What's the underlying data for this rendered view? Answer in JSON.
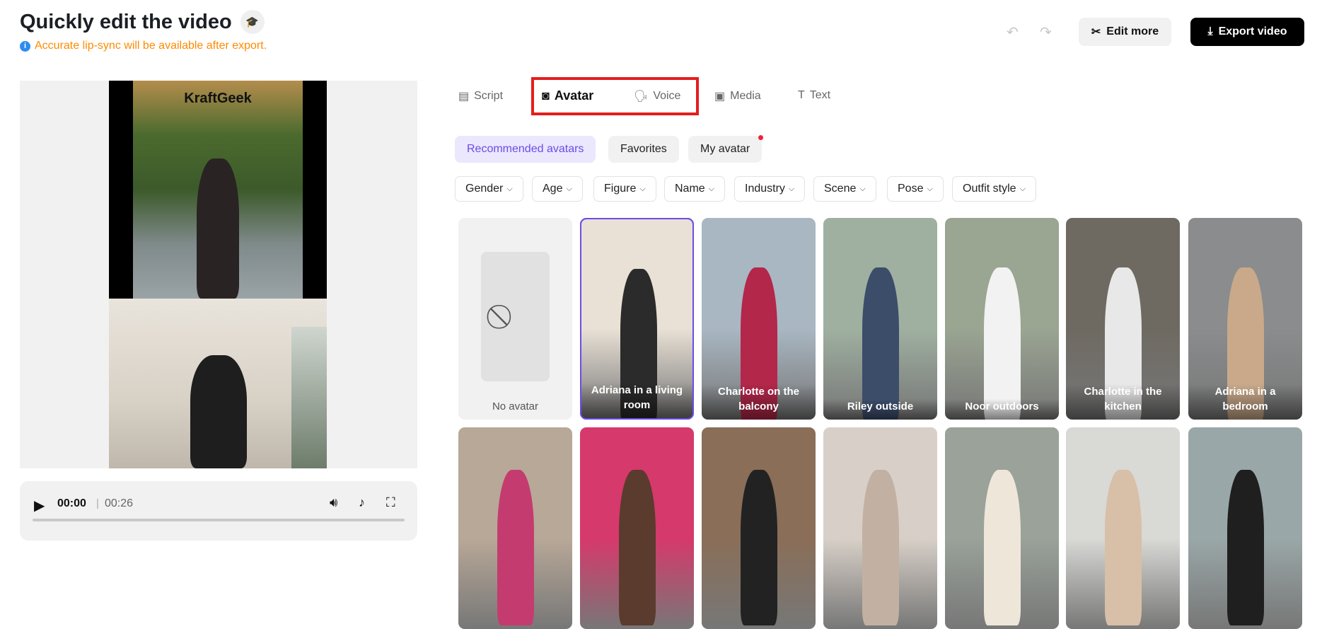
{
  "header": {
    "title": "Quickly edit the video",
    "notice": "Accurate lip-sync will be available after export.",
    "edit_more": "Edit more",
    "export": "Export video"
  },
  "video": {
    "watermark": "KraftGeek",
    "current_time": "00:00",
    "duration": "00:26",
    "progress": 0
  },
  "tabs": [
    {
      "label": "Script",
      "icon": "script-icon"
    },
    {
      "label": "Avatar",
      "icon": "avatar-icon",
      "active": true
    },
    {
      "label": "Voice",
      "icon": "voice-icon"
    },
    {
      "label": "Media",
      "icon": "media-icon"
    },
    {
      "label": "Text",
      "icon": "text-icon"
    }
  ],
  "subtabs": [
    {
      "label": "Recommended avatars",
      "selected": true
    },
    {
      "label": "Favorites"
    },
    {
      "label": "My avatar",
      "badge": true
    }
  ],
  "filters": [
    "Gender",
    "Age",
    "Figure",
    "Name",
    "Industry",
    "Scene",
    "Pose",
    "Outfit style"
  ],
  "avatars_row1": [
    "No avatar",
    "Adriana in a living room",
    "Charlotte on the balcony",
    "Riley outside",
    "Noor outdoors",
    "Charlotte in the kitchen",
    "Adriana in a bedroom"
  ],
  "colors": {
    "accent": "#6a4ce8",
    "highlight_box": "#e41e1e",
    "notice": "#ff8a00"
  }
}
